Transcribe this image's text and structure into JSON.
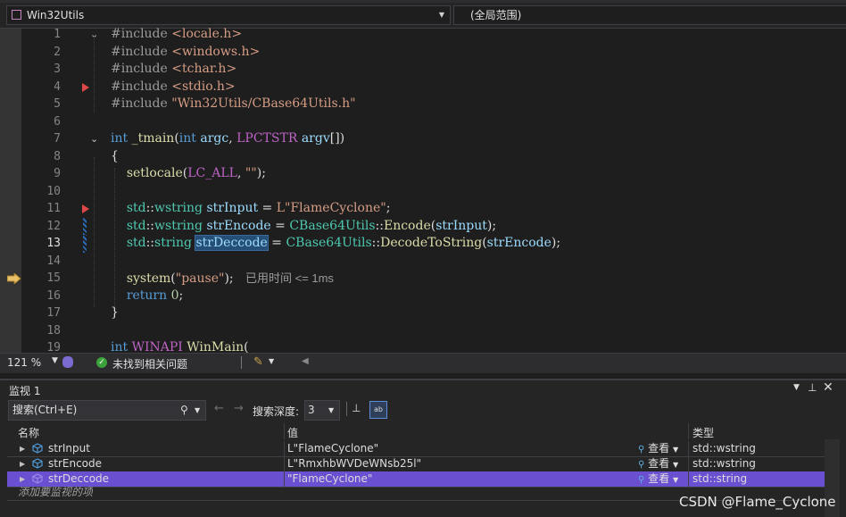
{
  "navbar": {
    "project": "Win32Utils",
    "scope": "(全局范围)"
  },
  "editor": {
    "lines": [
      {
        "n": "1",
        "html": "<span class='pp'>#include</span> <span class='s'>&lt;locale.h&gt;</span>"
      },
      {
        "n": "2",
        "html": "<span class='pp'>#include</span> <span class='s'>&lt;windows.h&gt;</span>"
      },
      {
        "n": "3",
        "html": "<span class='pp'>#include</span> <span class='s'>&lt;tchar.h&gt;</span>"
      },
      {
        "n": "4",
        "html": "<span class='pp'>#include</span> <span class='s'>&lt;stdio.h&gt;</span>"
      },
      {
        "n": "5",
        "html": "<span class='pp'>#include</span> <span class='s'>\"Win32Utils/CBase64Utils.h\"</span>"
      },
      {
        "n": "6",
        "html": ""
      },
      {
        "n": "7",
        "html": "<span class='k'>int</span> <span class='fn'>_tmain</span>(<span class='k'>int</span> <span class='v'>argc</span>, <span class='m'>LPCTSTR</span> <span class='v'>argv</span>[])"
      },
      {
        "n": "8",
        "html": "{"
      },
      {
        "n": "9",
        "html": "    <span class='fn'>setlocale</span>(<span class='m'>LC_ALL</span>, <span class='s'>\"\"</span>);"
      },
      {
        "n": "10",
        "html": ""
      },
      {
        "n": "11",
        "html": "    <span class='t'>std</span>::<span class='t'>wstring</span> <span class='v'>strInput</span> = <span class='s'>L\"FlameCyclone\"</span>;"
      },
      {
        "n": "12",
        "html": "    <span class='t'>std</span>::<span class='t'>wstring</span> <span class='v'>strEncode</span> = <span class='t'>CBase64Utils</span>::<span class='fn'>Encode</span>(<span class='v'>strInput</span>);"
      },
      {
        "n": "13",
        "html": "    <span class='t'>std</span>::<span class='t'>string</span> <span class='v hl'>strDeccode</span> = <span class='t'>CBase64Utils</span>::<span class='fn'>DecodeToString</span>(<span class='v'>strEncode</span>);"
      },
      {
        "n": "14",
        "html": ""
      },
      {
        "n": "15",
        "html": "    <span class='fn'>system</span>(<span class='s'>\"pause\"</span>);   <span class='hint'>已用时间 &lt;= 1ms</span>"
      },
      {
        "n": "16",
        "html": "    <span class='k'>return</span> <span class='n'>0</span>;"
      },
      {
        "n": "17",
        "html": "}"
      },
      {
        "n": "18",
        "html": ""
      },
      {
        "n": "19",
        "html": "<span class='k'>int</span> <span class='m'>WINAPI</span> <span class='fn'>WinMain</span>("
      }
    ]
  },
  "statusbar": {
    "zoom": "121 %",
    "issues": "未找到相关问题"
  },
  "watch": {
    "title": "监视 1",
    "search_placeholder": "搜索(Ctrl+E)",
    "depth_label": "搜索深度:",
    "depth_value": "3",
    "columns": {
      "name": "名称",
      "value": "值",
      "type": "类型"
    },
    "rows": [
      {
        "name": "strInput",
        "value": "L\"FlameCyclone\"",
        "view": "查看",
        "type": "std::wstring"
      },
      {
        "name": "strEncode",
        "value": "L\"RmxhbWVDeWNsb25l\"",
        "view": "查看",
        "type": "std::wstring"
      },
      {
        "name": "strDeccode",
        "value": "\"FlameCyclone\"",
        "view": "查看",
        "type": "std::string"
      }
    ],
    "add_placeholder": "添加要监视的项"
  },
  "watermark": "CSDN @Flame_Cyclone"
}
